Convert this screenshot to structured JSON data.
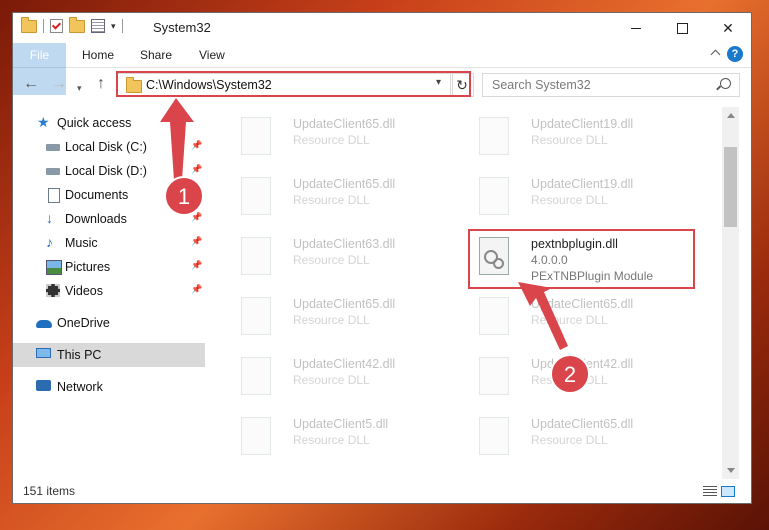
{
  "window": {
    "title": "System32"
  },
  "ribbon": {
    "file_label": "File",
    "tabs": [
      "Home",
      "Share",
      "View"
    ],
    "help_label": "?"
  },
  "address": {
    "path": "C:\\Windows\\System32",
    "search_placeholder": "Search System32"
  },
  "sidebar": {
    "items": [
      {
        "label": "Quick access",
        "icon": "star-icon"
      },
      {
        "label": "Local Disk (C:)",
        "icon": "drive-icon"
      },
      {
        "label": "Local Disk (D:)",
        "icon": "drive-icon"
      },
      {
        "label": "Documents",
        "icon": "documents-icon"
      },
      {
        "label": "Downloads",
        "icon": "downloads-icon"
      },
      {
        "label": "Music",
        "icon": "music-icon"
      },
      {
        "label": "Pictures",
        "icon": "pictures-icon"
      },
      {
        "label": "Videos",
        "icon": "videos-icon"
      },
      {
        "label": "OneDrive",
        "icon": "cloud-icon"
      },
      {
        "label": "This PC",
        "icon": "computer-icon"
      },
      {
        "label": "Network",
        "icon": "network-icon"
      }
    ]
  },
  "files": {
    "col1": [
      {
        "name": "UpdateClient65.dll",
        "type": "Resource DLL"
      },
      {
        "name": "UpdateClient65.dll",
        "type": "Resource DLL"
      },
      {
        "name": "UpdateClient63.dll",
        "type": "Resource DLL"
      },
      {
        "name": "UpdateClient65.dll",
        "type": "Resource DLL"
      },
      {
        "name": "UpdateClient42.dll",
        "type": "Resource DLL"
      },
      {
        "name": "UpdateClient5.dll",
        "type": "Resource DLL"
      }
    ],
    "col2": [
      {
        "name": "UpdateClient19.dll",
        "type": "Resource DLL"
      },
      {
        "name": "UpdateClient19.dll",
        "type": "Resource DLL"
      },
      {
        "name": "UpdateClient65.dll",
        "type": "Resource DLL"
      },
      {
        "name": "UpdateClient42.dll",
        "type": "Resource DLL"
      },
      {
        "name": "UpdateClient65.dll",
        "type": "Resource DLL"
      }
    ],
    "target": {
      "name": "pextnbplugin.dll",
      "version": "4.0.0.0",
      "type": "PExTNBPlugin Module"
    }
  },
  "status": {
    "count": "151 items"
  },
  "annotations": {
    "step1": "1",
    "step2": "2",
    "color": "#d9454a"
  }
}
